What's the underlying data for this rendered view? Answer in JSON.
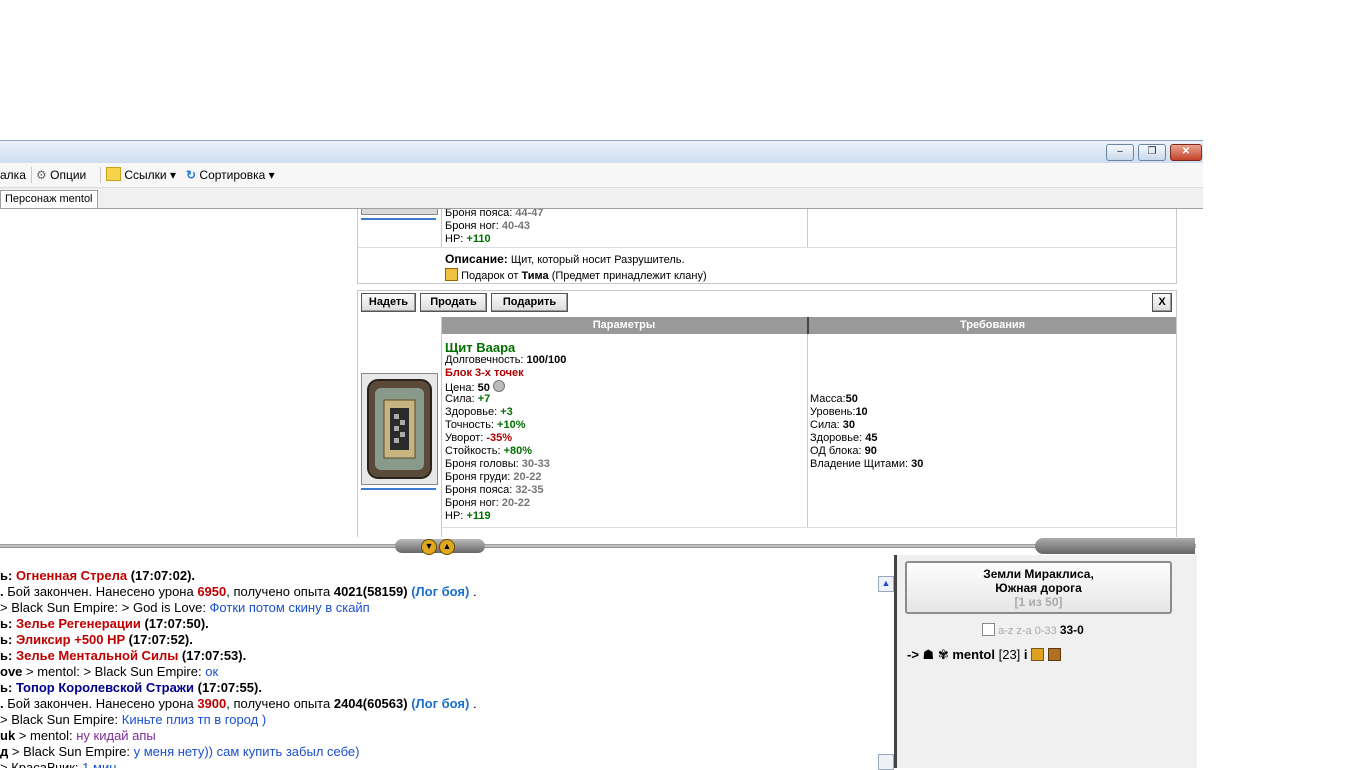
{
  "window": {
    "minimize": "–",
    "restore": "❐",
    "close": "✕"
  },
  "toolbar": {
    "partial_item": "алка",
    "options": "Опции",
    "links": "Ссылки",
    "sort": "Сортировка",
    "dropdown_glyph": "▾"
  },
  "tabs": {
    "character": "Персонаж mentol"
  },
  "item_top": {
    "lines": [
      {
        "label": "Броня пояса:",
        "value": "44-47"
      },
      {
        "label": "Броня ног:",
        "value": "40-43"
      },
      {
        "label": "HP:",
        "value": "+110"
      }
    ],
    "description_label": "Описание:",
    "description_text": "Щит, который носит Разрушитель.",
    "gift_prefix": "Подарок от",
    "gift_from": "Тима",
    "gift_note": "(Предмет принадлежит клану)"
  },
  "item_actions": {
    "wear": "Надеть",
    "sell": "Продать",
    "gift": "Подарить",
    "close": "X"
  },
  "columns": {
    "params": "Параметры",
    "reqs": "Требования"
  },
  "item": {
    "name": "Щит Ваара",
    "durability_label": "Долговечность:",
    "durability": "100/100",
    "special": "Блок 3-х точек",
    "price_label": "Цена:",
    "price": "50",
    "stats": [
      {
        "label": "Сила:",
        "value": "+7",
        "tone": "green"
      },
      {
        "label": "Здоровье:",
        "value": "+3",
        "tone": "green"
      },
      {
        "label": "Точность:",
        "value": "+10%",
        "tone": "green"
      },
      {
        "label": "Уворот:",
        "value": "-35%",
        "tone": "red"
      },
      {
        "label": "Стойкость:",
        "value": "+80%",
        "tone": "green"
      },
      {
        "label": "Броня головы:",
        "value": "30-33",
        "tone": "gray"
      },
      {
        "label": "Броня груди:",
        "value": "20-22",
        "tone": "gray"
      },
      {
        "label": "Броня пояса:",
        "value": "32-35",
        "tone": "gray"
      },
      {
        "label": "Броня ног:",
        "value": "20-22",
        "tone": "gray"
      },
      {
        "label": "HP:",
        "value": "+119",
        "tone": "green"
      }
    ],
    "requirements": [
      {
        "label": "Масса:",
        "value": "50"
      },
      {
        "label": "Уровень:",
        "value": "10"
      },
      {
        "label": "Сила:",
        "value": "30"
      },
      {
        "label": "Здоровье:",
        "value": "45"
      },
      {
        "label": "ОД блока:",
        "value": "90"
      },
      {
        "label": "Владение Щитами:",
        "value": "30"
      }
    ]
  },
  "chat": [
    {
      "a": "ь:",
      "b": " Огненная Стрела",
      "c": " (17:07:02)."
    },
    {
      "a": ".",
      "b": " Бой закончен. Нанесено урона ",
      "c": "6950",
      "d": ", получено опыта ",
      "e": "4021(58159)",
      "f": " (Лог боя)",
      "g": " ."
    },
    {
      "a": "> Black Sun Empire: > God is Love:",
      "b": " Фотки потом скину в скайп"
    },
    {
      "a": "ь:",
      "b": " Зелье Регенерации",
      "c": " (17:07:50)."
    },
    {
      "a": "ь:",
      "b": " Эликсир +500 HP",
      "c": " (17:07:52)."
    },
    {
      "a": "ь:",
      "b": " Зелье Ментальной Силы",
      "c": " (17:07:53)."
    },
    {
      "a": "ove",
      "b": " > mentol: > Black Sun Empire:",
      "c": " ок"
    },
    {
      "a": "ь:",
      "b": " Топор Королевской Стражи",
      "c": " (17:07:55)."
    },
    {
      "a": ".",
      "b": " Бой закончен. Нанесено урона ",
      "c": "3900",
      "d": ", получено опыта ",
      "e": "2404(60563)",
      "f": " (Лог боя)",
      "g": " ."
    },
    {
      "a": "> Black Sun Empire:",
      "b": " Киньте плиз тп в город )"
    },
    {
      "a": "uk",
      "b": " > mentol:",
      "c": " ну кидай апы"
    },
    {
      "a": "д",
      "b": " > Black Sun Empire:",
      "c": " у меня нету)) сам купить забыл себе)"
    },
    {
      "a": "> КрасаВчик:",
      "b": " 1 мин"
    }
  ],
  "location": {
    "line1": "Земли Мираклиса,",
    "line2": "Южная дорога",
    "page": "[1 из 50]"
  },
  "sort_row": {
    "options": "a-z z-a 0-33",
    "count": "33-0"
  },
  "player": {
    "arrow": "->",
    "name": "mentol",
    "level": "[23]",
    "info": "i"
  }
}
